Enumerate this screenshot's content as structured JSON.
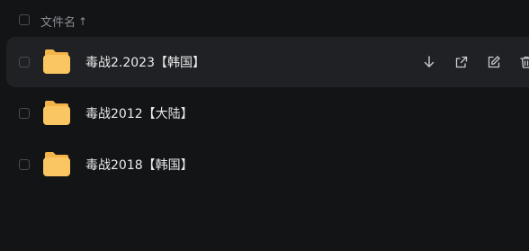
{
  "header": {
    "name_label": "文件名",
    "sort_indicator": "↑"
  },
  "files": [
    {
      "name": "毒战2.2023【韩国】",
      "icon": "folder-icon",
      "hovered": true
    },
    {
      "name": "毒战2012【大陆】",
      "icon": "folder-icon",
      "hovered": false
    },
    {
      "name": "毒战2018【韩国】",
      "icon": "folder-icon",
      "hovered": false
    }
  ],
  "row_actions": [
    "download-icon",
    "share-icon",
    "edit-icon",
    "delete-icon"
  ],
  "colors": {
    "background": "#131416",
    "row_hover": "#202124",
    "folder": "#f9c661",
    "text": "#e9eaec",
    "muted": "#8a8d93"
  }
}
